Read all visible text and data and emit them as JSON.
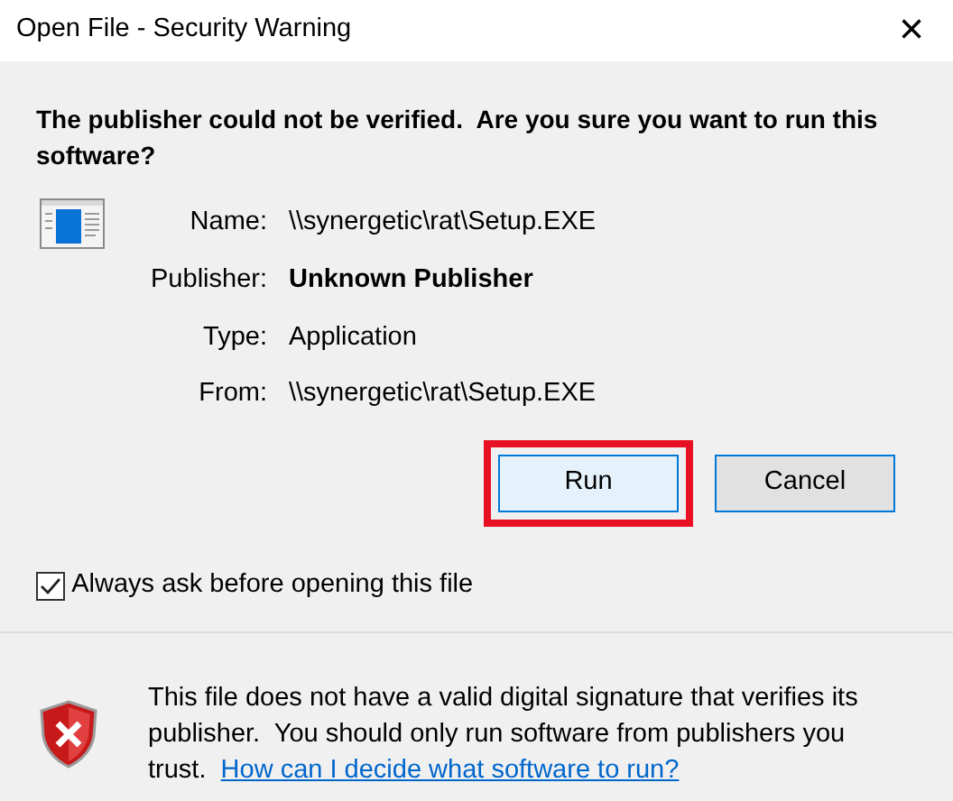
{
  "window": {
    "title": "Open File - Security Warning",
    "close": "×"
  },
  "heading": "The publisher could not be verified.  Are you sure you want to run this software?",
  "details": [
    {
      "label": "Name:",
      "value": "\\\\synergetic\\rat\\Setup.EXE",
      "emphasis": false
    },
    {
      "label": "Publisher:",
      "value": "Unknown Publisher",
      "emphasis": true
    },
    {
      "label": "Type:",
      "value": "Application",
      "emphasis": false
    },
    {
      "label": "From:",
      "value": "\\\\synergetic\\rat\\Setup.EXE",
      "emphasis": false
    }
  ],
  "buttons": [
    {
      "label": "Run",
      "default": true,
      "highlighted": true
    },
    {
      "label": "Cancel",
      "default": false,
      "highlighted": false
    }
  ],
  "always_ask": {
    "label": "Always ask before opening this file",
    "checked": true
  },
  "footer": {
    "text": "This file does not have a valid digital signature that verifies its publisher.  You should only run software from publishers you trust.",
    "link": "How can I decide what software to run?"
  }
}
